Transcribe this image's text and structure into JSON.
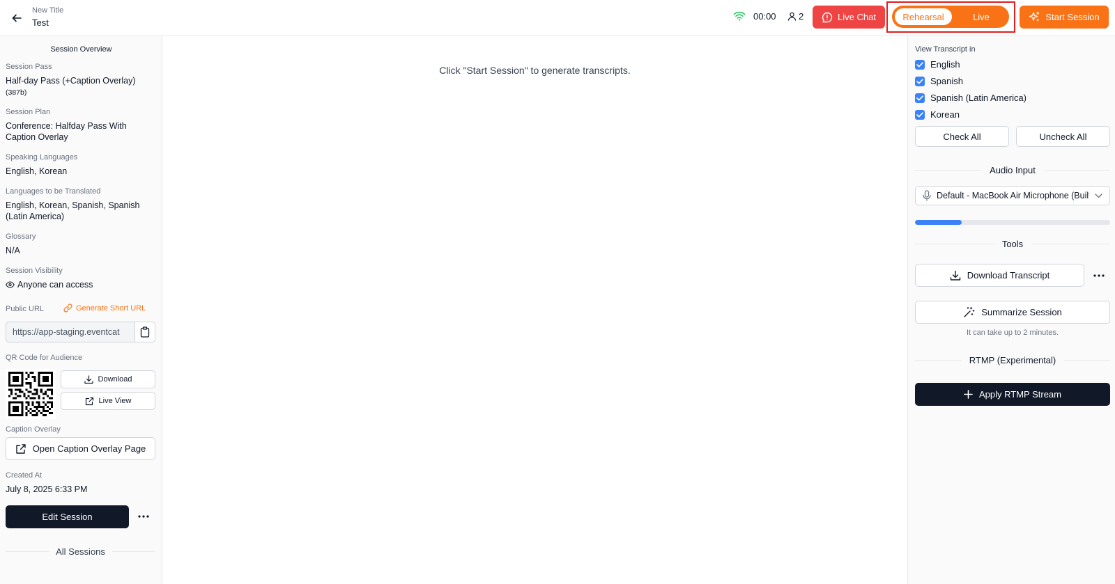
{
  "header": {
    "subtitle": "New Title",
    "title": "Test",
    "timer": "00:00",
    "viewer_count": "2",
    "live_chat_label": "Live Chat",
    "mode_options": [
      "Rehearsal",
      "Live"
    ],
    "mode_selected": "Rehearsal",
    "start_label": "Start Session"
  },
  "overview": {
    "title": "Session Overview",
    "pass_label": "Session Pass",
    "pass_value": "Half-day Pass (+Caption Overlay)",
    "pass_id": "(387b)",
    "plan_label": "Session Plan",
    "plan_value": "Conference: Halfday Pass With Caption Overlay",
    "speaking_label": "Speaking Languages",
    "speaking_value": "English, Korean",
    "translated_label": "Languages to be Translated",
    "translated_value": "English, Korean, Spanish, Spanish (Latin America)",
    "glossary_label": "Glossary",
    "glossary_value": "N/A",
    "visibility_label": "Session Visibility",
    "visibility_value": "Anyone can access",
    "public_url_label": "Public URL",
    "generate_short_url": "Generate Short URL",
    "public_url_value": "https://app-staging.eventcat",
    "qr_label": "QR Code for Audience",
    "download_label": "Download",
    "live_view_label": "Live View",
    "caption_label": "Caption Overlay",
    "caption_button": "Open Caption Overlay Page",
    "created_label": "Created At",
    "created_value": "July 8, 2025 6:33 PM",
    "edit_label": "Edit Session",
    "all_sessions_label": "All Sessions"
  },
  "main": {
    "hint": "Click \"Start Session\" to generate transcripts."
  },
  "right": {
    "view_transcript_label": "View Transcript in",
    "languages": [
      {
        "label": "English",
        "checked": true
      },
      {
        "label": "Spanish",
        "checked": true
      },
      {
        "label": "Spanish (Latin America)",
        "checked": true
      },
      {
        "label": "Korean",
        "checked": true
      }
    ],
    "check_all": "Check All",
    "uncheck_all": "Uncheck All",
    "audio_input_title": "Audio Input",
    "audio_device": "Default - MacBook Air Microphone (Built-in)",
    "audio_level": 0.24,
    "tools_title": "Tools",
    "download_transcript": "Download Transcript",
    "summarize": "Summarize Session",
    "summarize_note": "It can take up to 2 minutes.",
    "rtmp_title": "RTMP (Experimental)",
    "rtmp_button": "Apply RTMP Stream"
  },
  "colors": {
    "accent_orange": "#f97316",
    "live_chat_red": "#ef4444",
    "checkbox_blue": "#3b82f6",
    "dark_button": "#111827",
    "highlight_box": "#e11d1d",
    "wifi_green": "#22c55e"
  },
  "icons": {
    "back": "arrow-left-icon",
    "wifi": "wifi-icon",
    "viewer": "user-icon",
    "chat": "chat-alert-icon",
    "start": "sparkles-icon",
    "eye": "eye-icon",
    "link": "link-icon",
    "copy": "clipboard-icon",
    "download": "download-icon",
    "external": "external-link-icon",
    "more": "more-horizontal-icon",
    "mic": "microphone-icon",
    "chevron": "chevron-down-icon",
    "wand": "magic-wand-icon",
    "plus": "plus-icon",
    "check": "check-icon"
  }
}
